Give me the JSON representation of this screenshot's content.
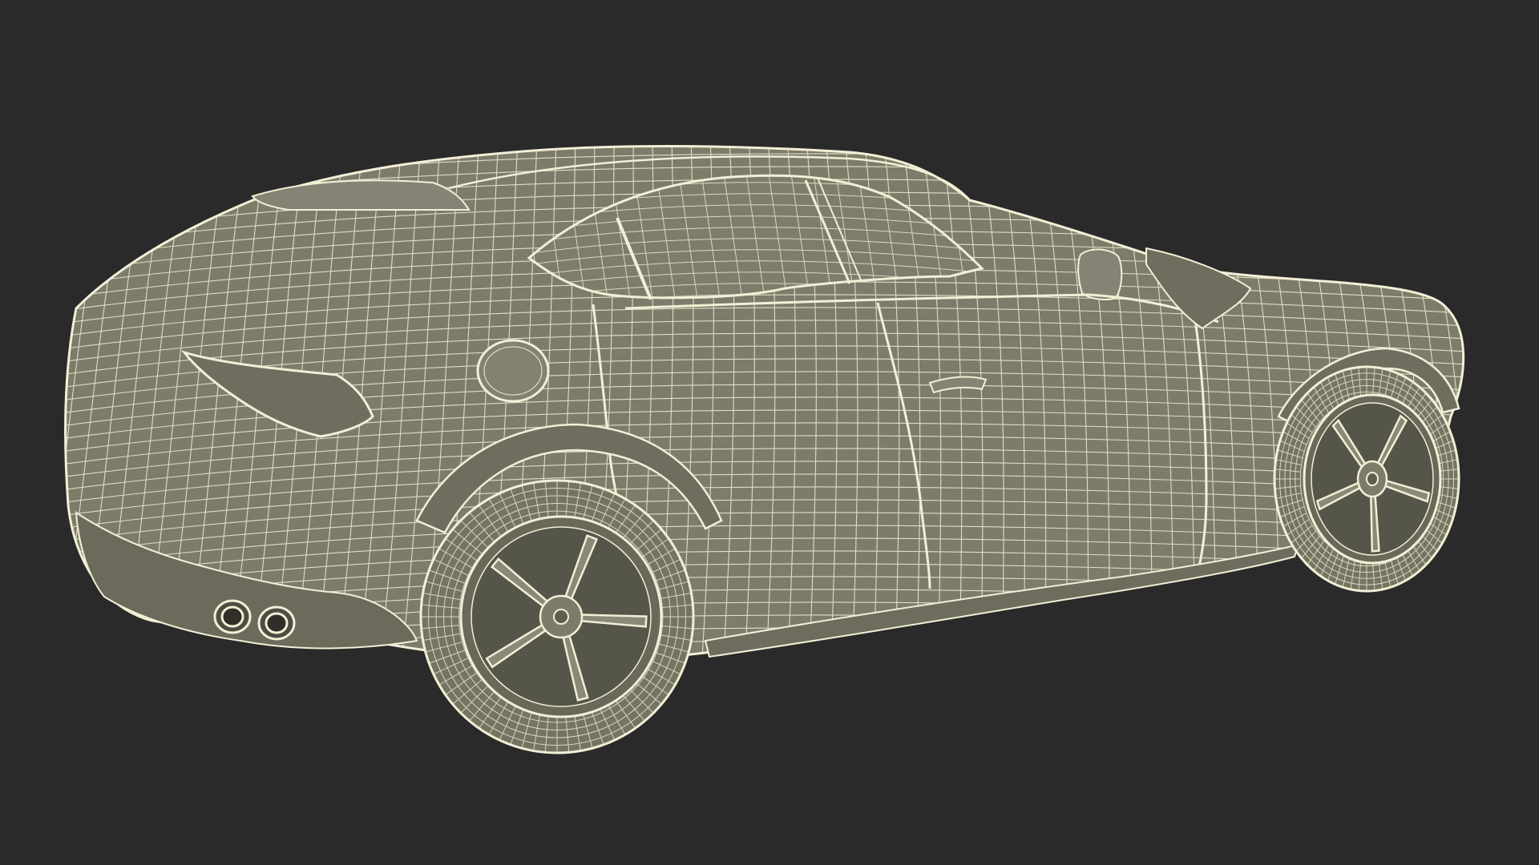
{
  "scene": {
    "subject": "sports-suv-wireframe-render",
    "background_color": "#2a2a2a",
    "surface_color": "#7d7b6a",
    "surface_shadow_color": "#5e5c4f",
    "wire_color": "#f2efd6",
    "glass_color": "#7e7c6b"
  }
}
